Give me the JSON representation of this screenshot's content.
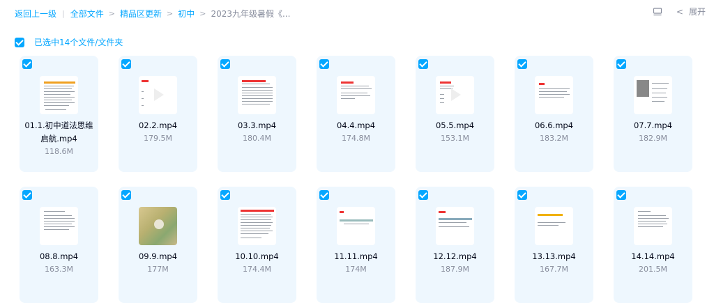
{
  "breadcrumb": {
    "back": "返回上一级",
    "all_files": "全部文件",
    "level1": "精品区更新",
    "level2": "初中",
    "current": "2023九年级暑假《..."
  },
  "toolbar": {
    "expand_label": "展开",
    "list_view_icon": "list-view-icon"
  },
  "selection": {
    "text": "已选中14个文件/文件夹"
  },
  "files": [
    {
      "name": "01.1.初中道法思维启航.mp4",
      "size": "118.6M"
    },
    {
      "name": "02.2.mp4",
      "size": "179.5M"
    },
    {
      "name": "03.3.mp4",
      "size": "180.4M"
    },
    {
      "name": "04.4.mp4",
      "size": "174.8M"
    },
    {
      "name": "05.5.mp4",
      "size": "153.1M"
    },
    {
      "name": "06.6.mp4",
      "size": "183.2M"
    },
    {
      "name": "07.7.mp4",
      "size": "182.9M"
    },
    {
      "name": "08.8.mp4",
      "size": "163.3M"
    },
    {
      "name": "09.9.mp4",
      "size": "177M"
    },
    {
      "name": "10.10.mp4",
      "size": "174.4M"
    },
    {
      "name": "11.11.mp4",
      "size": "174M"
    },
    {
      "name": "12.12.mp4",
      "size": "187.9M"
    },
    {
      "name": "13.13.mp4",
      "size": "167.7M"
    },
    {
      "name": "14.14.mp4",
      "size": "201.5M"
    }
  ],
  "colors": {
    "accent": "#06a7ff",
    "card_bg": "#eef7fe",
    "muted": "#878c9c"
  }
}
